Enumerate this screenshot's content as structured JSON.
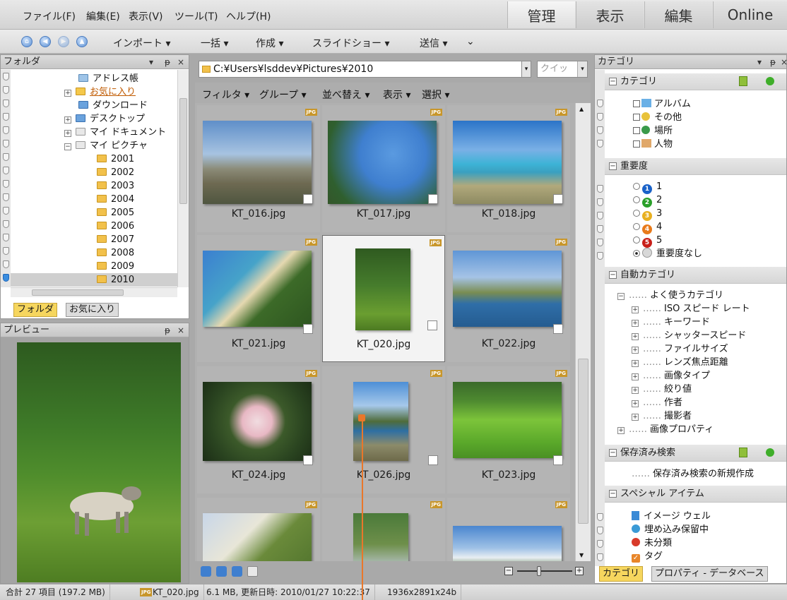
{
  "menu": {
    "items": [
      "ファイル(F)",
      "編集(E)",
      "表示(V)",
      "ツール(T)",
      "ヘルプ(H)"
    ],
    "modes": [
      "管理",
      "表示",
      "編集",
      "Online"
    ],
    "active_mode": "管理"
  },
  "toolbar": {
    "nav_icons": [
      "home-icon",
      "back-icon",
      "forward-icon",
      "up-icon"
    ],
    "items": [
      "インポート ▾",
      "一括 ▾",
      "作成 ▾",
      "スライドショー ▾",
      "送信 ▾"
    ],
    "overflow": "⌄"
  },
  "folder_panel": {
    "title": "フォルダ",
    "controls": [
      "▾",
      "ᵽ",
      "×"
    ],
    "tree": [
      {
        "label": "アドレス帳",
        "expander": ""
      },
      {
        "label": "お気に入り",
        "expander": "+"
      },
      {
        "label": "ダウンロード",
        "expander": ""
      },
      {
        "label": "デスクトップ",
        "expander": "+"
      },
      {
        "label": "マイ ドキュメント",
        "expander": "+"
      },
      {
        "label": "マイ ピクチャ",
        "expander": "−"
      },
      {
        "label": "2001",
        "expander": ""
      },
      {
        "label": "2002",
        "expander": ""
      },
      {
        "label": "2003",
        "expander": ""
      },
      {
        "label": "2004",
        "expander": ""
      },
      {
        "label": "2005",
        "expander": ""
      },
      {
        "label": "2006",
        "expander": ""
      },
      {
        "label": "2007",
        "expander": ""
      },
      {
        "label": "2008",
        "expander": ""
      },
      {
        "label": "2009",
        "expander": ""
      },
      {
        "label": "2010",
        "expander": ""
      }
    ],
    "tabs": [
      "フォルダ",
      "お気に入り"
    ],
    "active_tab": "フォルダ"
  },
  "preview_panel": {
    "title": "プレビュー",
    "controls": [
      "ᵽ",
      "×"
    ]
  },
  "pathbar": {
    "path": "C:¥Users¥lsddev¥Pictures¥2010",
    "quick_placeholder": "クイッ"
  },
  "filterbar": {
    "items": [
      "フィルタ ▾",
      "グループ ▾",
      "並べ替え ▾",
      "表示 ▾",
      "選択 ▾"
    ]
  },
  "thumbnails": [
    {
      "name": "KT_016.jpg",
      "badge": "JPG"
    },
    {
      "name": "KT_017.jpg",
      "badge": "JPG"
    },
    {
      "name": "KT_018.jpg",
      "badge": "JPG"
    },
    {
      "name": "KT_021.jpg",
      "badge": "JPG"
    },
    {
      "name": "KT_020.jpg",
      "badge": "JPG",
      "selected": true
    },
    {
      "name": "KT_022.jpg",
      "badge": "JPG"
    },
    {
      "name": "KT_024.jpg",
      "badge": "JPG"
    },
    {
      "name": "KT_026.jpg",
      "badge": "JPG"
    },
    {
      "name": "KT_023.jpg",
      "badge": "JPG"
    },
    {
      "name": "",
      "badge": "JPG"
    },
    {
      "name": "",
      "badge": "JPG"
    },
    {
      "name": "",
      "badge": "JPG"
    }
  ],
  "category_panel": {
    "title": "カテゴリ",
    "controls": [
      "▾",
      "ᵽ",
      "×"
    ],
    "sections": {
      "category": {
        "title": "カテゴリ",
        "items": [
          "アルバム",
          "その他",
          "場所",
          "人物"
        ]
      },
      "rating": {
        "title": "重要度",
        "items": [
          "1",
          "2",
          "3",
          "4",
          "5",
          "重要度なし"
        ],
        "selected": "重要度なし"
      },
      "auto": {
        "title": "自動カテゴリ",
        "root": "よく使うカテゴリ",
        "items": [
          "ISO スピード レート",
          "キーワード",
          "シャッタースピード",
          "ファイルサイズ",
          "レンズ焦点距離",
          "画像タイプ",
          "絞り値",
          "作者",
          "撮影者"
        ],
        "extra": "画像プロパティ"
      },
      "saved": {
        "title": "保存済み検索",
        "item": "保存済み検索の新規作成"
      },
      "special": {
        "title": "スペシャル アイテム",
        "items": [
          "イメージ ウェル",
          "埋め込み保留中",
          "未分類",
          "タグ"
        ]
      }
    },
    "tabs": [
      "カテゴリ",
      "プロパティ - データベース"
    ],
    "active_tab": "カテゴリ"
  },
  "statusbar": {
    "total": "合計 27 項目  (197.2 MB)",
    "current_file": "KT_020.jpg",
    "file_info": "6.1 MB, 更新日時: 2010/01/27 10:22:37",
    "dimensions": "1936x2891x24b"
  },
  "colors": {
    "accent_orange": "#e9772a",
    "folder_yellow": "#f2c14b",
    "nav_blue": "#5b8fd3"
  }
}
